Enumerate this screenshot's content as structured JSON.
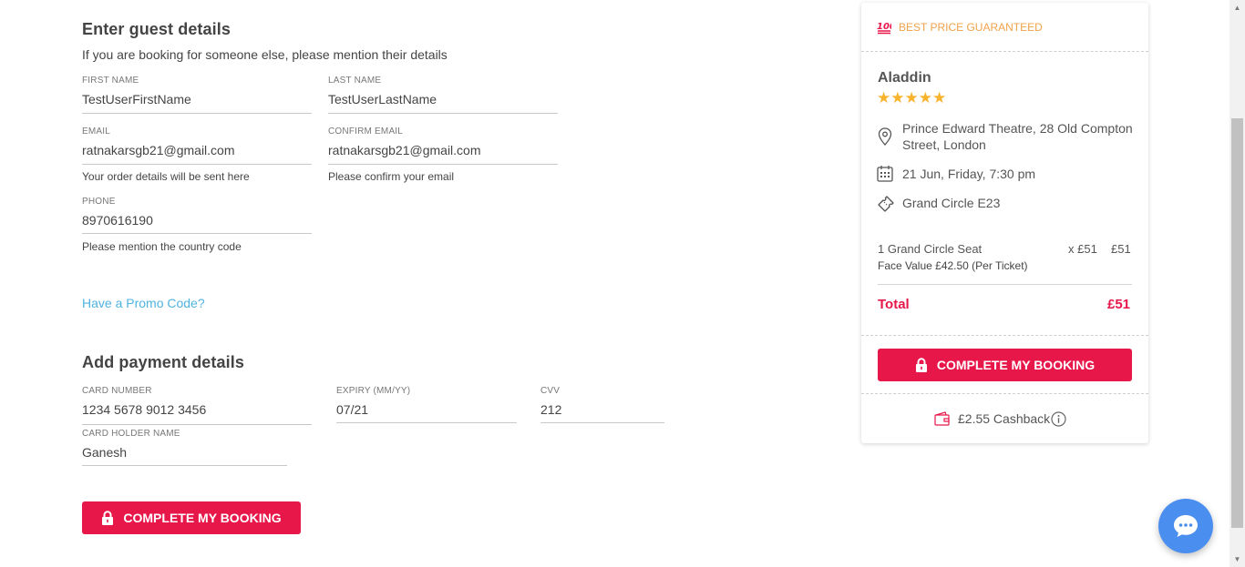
{
  "guest": {
    "title": "Enter guest details",
    "subtitle": "If you are booking for someone else, please mention their details",
    "first_name": {
      "label": "FIRST NAME",
      "value": "TestUserFirstName"
    },
    "last_name": {
      "label": "LAST NAME",
      "value": "TestUserLastName"
    },
    "email": {
      "label": "EMAIL",
      "value": "ratnakarsgb21@gmail.com",
      "hint": "Your order details will be sent here"
    },
    "confirm_email": {
      "label": "CONFIRM EMAIL",
      "value": "ratnakarsgb21@gmail.com",
      "hint": "Please confirm your email"
    },
    "phone": {
      "label": "PHONE",
      "value": "8970616190",
      "hint": "Please mention the country code"
    },
    "promo_link": "Have a Promo Code?"
  },
  "payment": {
    "title": "Add payment details",
    "card_number": {
      "label": "CARD NUMBER",
      "value": "1234 5678 9012 3456"
    },
    "expiry": {
      "label": "EXPIRY (MM/YY)",
      "value": "07/21"
    },
    "cvv": {
      "label": "CVV",
      "value": "212"
    },
    "holder": {
      "label": "CARD HOLDER NAME",
      "value": "Ganesh"
    },
    "submit_label": "COMPLETE MY BOOKING"
  },
  "summary": {
    "badge": "BEST PRICE GUARANTEED",
    "badge_icon": "100-emoji-icon",
    "show_title": "Aladdin",
    "rating": 5,
    "stars": "★★★★★",
    "venue_line1": "Prince Edward Theatre, 28 Old Compton",
    "venue_line2": "Street, London",
    "datetime": "21 Jun, Friday, 7:30 pm",
    "seat": "Grand Circle E23",
    "line_item": "1 Grand Circle Seat",
    "line_qty": "x £51",
    "line_price": "£51",
    "face_value": "Face Value £42.50 (Per Ticket)",
    "total_label": "Total",
    "total_value": "£51",
    "cta_label": "COMPLETE MY BOOKING",
    "cashback": "£2.55 Cashback"
  },
  "colors": {
    "accent": "#e8174a",
    "link": "#4fb3e0",
    "badge": "#f0a24a",
    "star": "#f7b32b",
    "chat": "#4a8ef0"
  }
}
